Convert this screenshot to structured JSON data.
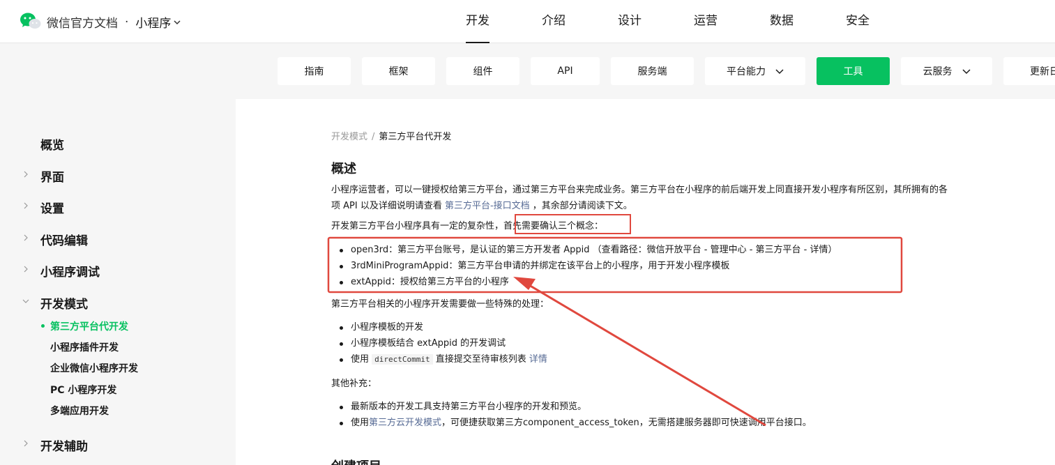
{
  "header": {
    "brand": "微信官方文档",
    "dot": "·",
    "product": "小程序",
    "nav": [
      "开发",
      "介绍",
      "设计",
      "运营",
      "数据",
      "安全"
    ],
    "active_nav": "开发"
  },
  "subnav": {
    "items": [
      {
        "label": "指南"
      },
      {
        "label": "框架"
      },
      {
        "label": "组件"
      },
      {
        "label": "API"
      },
      {
        "label": "服务端"
      },
      {
        "label": "平台能力"
      },
      {
        "label": "工具"
      },
      {
        "label": "云服务"
      },
      {
        "label": "更新日"
      }
    ],
    "active": "工具"
  },
  "sidebar": {
    "items": [
      {
        "label": "概览"
      },
      {
        "label": "界面"
      },
      {
        "label": "设置"
      },
      {
        "label": "代码编辑"
      },
      {
        "label": "小程序调试"
      },
      {
        "label": "开发模式"
      },
      {
        "label": "开发辅助"
      }
    ],
    "subitems": [
      {
        "label": "第三方平台代开发"
      },
      {
        "label": "小程序插件开发"
      },
      {
        "label": "企业微信小程序开发"
      },
      {
        "label": "PC 小程序开发"
      },
      {
        "label": "多端应用开发"
      }
    ],
    "active_sub": "第三方平台代开发"
  },
  "main": {
    "breadcrumb": {
      "parent": "开发模式",
      "sep": "/",
      "current": "第三方平台代开发"
    },
    "title": "概述",
    "intro_line1": "小程序运营者，可以一键授权给第三方平台，通过第三方平台来完成业务。第三方平台在小程序的前后端开发上同直接开发小程序有所区别，其所拥有的各",
    "intro_line2_pre": "项 API 以及详细说明请查看 ",
    "intro_link": "第三方平台-接口文档",
    "intro_line2_post": " ，其余部分请阅读下文。",
    "complexity_pre": "开发第三方平台小程序具有一定的复杂性，",
    "complexity_boxed": "首先需要确认三个概念：",
    "concepts": [
      "open3rd：第三方平台账号，是认证的第三方开发者 Appid （查看路径：微信开放平台 - 管理中心 - 第三方平台 - 详情）",
      "3rdMiniProgramAppid：第三方平台申请的并绑定在该平台上的小程序，用于开发小程序模板",
      "extAppid：授权给第三方平台的小程序"
    ],
    "special_intro": "第三方平台相关的小程序开发需要做一些特殊的处理：",
    "special_items": [
      {
        "text": "小程序模板的开发"
      },
      {
        "text": "小程序模板结合 extAppid 的开发调试"
      },
      {
        "pre": "使用 ",
        "code": "directCommit",
        "mid": " 直接提交至待审核列表 ",
        "link": "详情"
      }
    ],
    "other_title": "其他补充：",
    "other_items": [
      {
        "text": "最新版本的开发工具支持第三方平台小程序的开发和预览。"
      },
      {
        "pre": "使用",
        "link": "第三方云开发模式",
        "post": "，可便捷获取第三方component_access_token，无需搭建服务器即可快速调用平台接口。"
      }
    ],
    "next_title": "创建项目"
  },
  "colors": {
    "accent_green": "#07c160",
    "link_blue": "#576b95",
    "annotation_red": "#e0483e",
    "sidebar_bg": "#f6f6f6"
  }
}
